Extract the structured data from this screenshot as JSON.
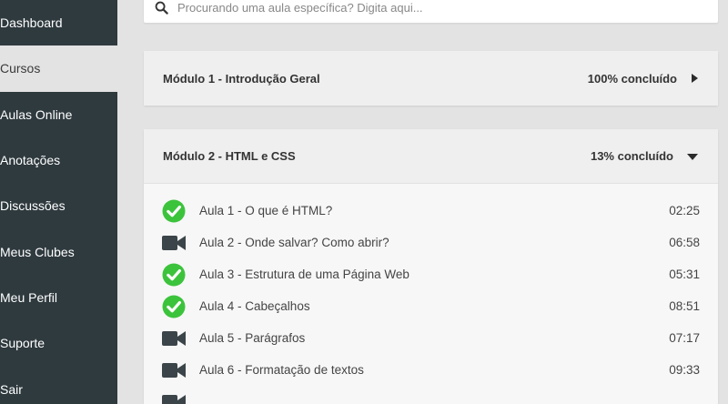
{
  "colors": {
    "sidebar_bg": "#2f3a3f",
    "page_bg": "#e3e3e3",
    "check_green": "#3cc33c",
    "video_dark": "#3b4449"
  },
  "sidebar": {
    "items": [
      {
        "label": "Dashboard",
        "active": false
      },
      {
        "label": "Cursos",
        "active": true
      },
      {
        "label": "Aulas Online",
        "active": false
      },
      {
        "label": "Anotações",
        "active": false
      },
      {
        "label": "Discussões",
        "active": false
      },
      {
        "label": "Meus Clubes",
        "active": false
      },
      {
        "label": "Meu Perfil",
        "active": false
      },
      {
        "label": "Suporte",
        "active": false
      },
      {
        "label": "Sair",
        "active": false
      }
    ]
  },
  "search": {
    "placeholder": "Procurando uma aula específica? Digita aqui...",
    "icon": "search-icon"
  },
  "modules": [
    {
      "title": "Módulo 1 - Introdução Geral",
      "progress": "100% concluído",
      "expanded": false,
      "icon": "caret-right-icon"
    },
    {
      "title": "Módulo 2 - HTML e CSS",
      "progress": "13% concluído",
      "expanded": true,
      "icon": "caret-down-icon",
      "lessons": [
        {
          "title": "Aula 1 - O que é HTML?",
          "duration": "02:25",
          "status": "done",
          "icon": "check-circle-icon"
        },
        {
          "title": "Aula 2 - Onde salvar? Como abrir?",
          "duration": "06:58",
          "status": "video",
          "icon": "video-camera-icon"
        },
        {
          "title": "Aula 3 - Estrutura de uma Página Web",
          "duration": "05:31",
          "status": "done",
          "icon": "check-circle-icon"
        },
        {
          "title": "Aula 4 - Cabeçalhos",
          "duration": "08:51",
          "status": "done",
          "icon": "check-circle-icon"
        },
        {
          "title": "Aula 5 - Parágrafos",
          "duration": "07:17",
          "status": "video",
          "icon": "video-camera-icon"
        },
        {
          "title": "Aula 6 - Formatação de textos",
          "duration": "09:33",
          "status": "video",
          "icon": "video-camera-icon"
        }
      ]
    }
  ]
}
